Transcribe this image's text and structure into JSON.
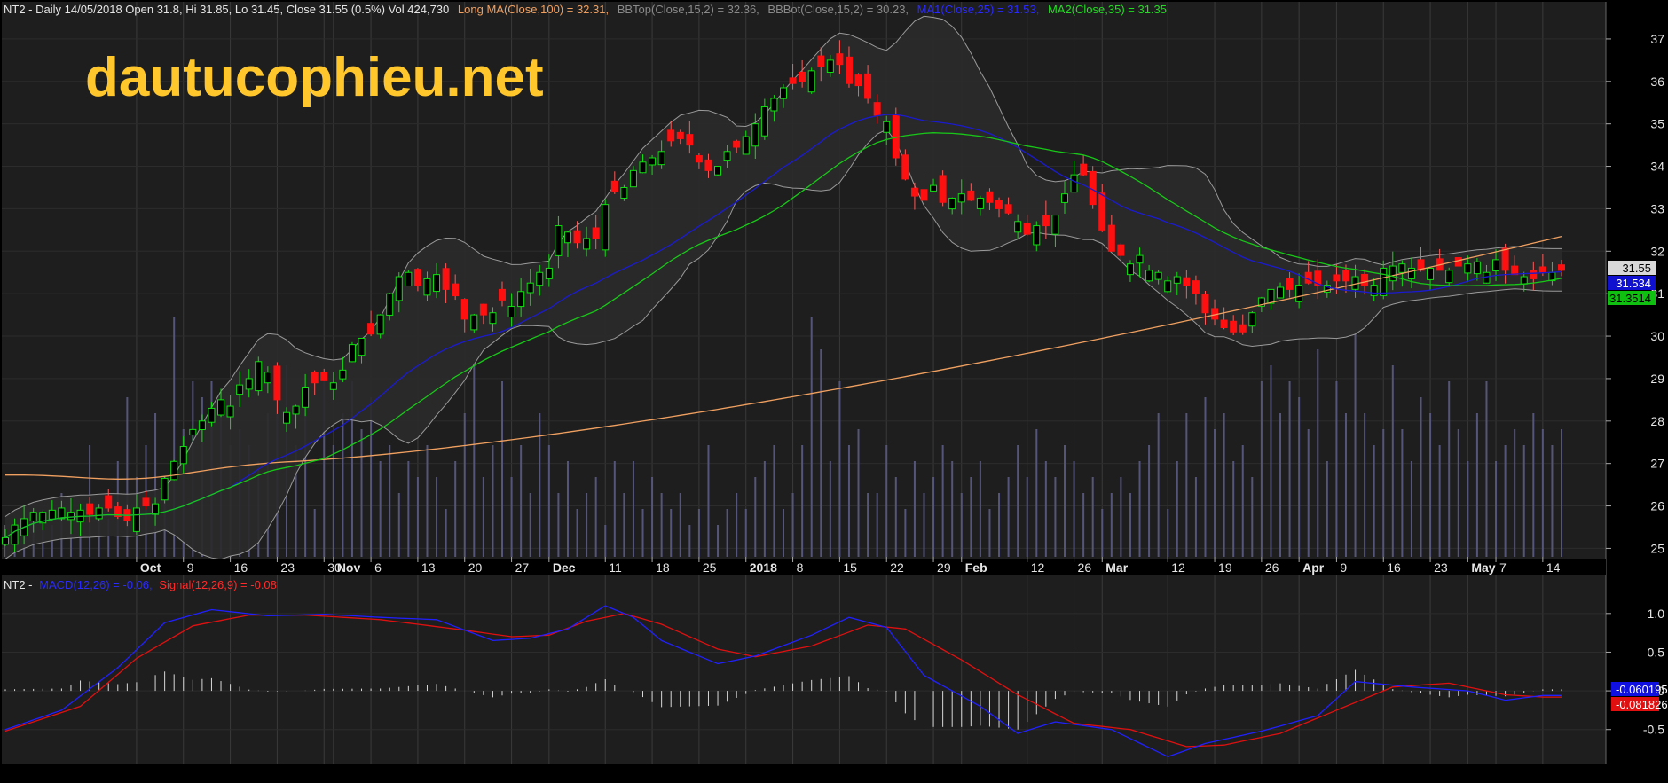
{
  "price_header": {
    "prefix": "NT2 - Daily 14/05/2018 Open 31.8, Hi 31.85, Lo 31.45, Close 31.55 (0.5%) Vol 424,730",
    "long_ma": "Long MA(Close,100) = 32.31,",
    "bbtop": "BBTop(Close,15,2) = 32.36,",
    "bbbot": "BBBot(Close,15,2) = 30.23,",
    "ma1": "MA1(Close,25) = 31.53,",
    "ma2": "MA2(Close,35) = 31.35"
  },
  "macd_header": {
    "prefix": "NT2 -",
    "macd": "MACD(12,26) = -0.06,",
    "signal": "Signal(12,26,9) = -0.08"
  },
  "watermark": "dautucophieu.net",
  "colors": {
    "background": "#000000",
    "panel": "#1e1e1e",
    "grid": "#3a3a3a",
    "up": "#10e010",
    "down": "#ff1010",
    "bb": "#9a9a9a",
    "bb_fill": "#2a2a2a",
    "long_ma": "#f0a060",
    "ma1": "#1a1ad0",
    "ma2": "#18c818",
    "volume": "#55557a",
    "macd": "#2020ff",
    "signal": "#e01010",
    "histogram": "#d8d8d8",
    "watermark": "#ffc72c"
  },
  "price_labels": {
    "close": "31.55",
    "ma1": "31.534",
    "ma2": "31.3514"
  },
  "macd_labels": {
    "macd": "-0.060195",
    "signal": "-0.081826"
  },
  "chart_data": [
    {
      "type": "candlestick",
      "title": "NT2 - Daily 14/05/2018",
      "ylim": [
        24.8,
        37.5
      ],
      "y_ticks": [
        25,
        26,
        27,
        28,
        29,
        30,
        31,
        32,
        33,
        34,
        35,
        36,
        37
      ],
      "x_tick_labels": [
        {
          "label": "Oct",
          "i": 14
        },
        {
          "label": "9",
          "i": 19
        },
        {
          "label": "16",
          "i": 24
        },
        {
          "label": "23",
          "i": 29
        },
        {
          "label": "30",
          "i": 34
        },
        {
          "label": "Nov",
          "i": 35
        },
        {
          "label": "6",
          "i": 39
        },
        {
          "label": "13",
          "i": 44
        },
        {
          "label": "20",
          "i": 49
        },
        {
          "label": "27",
          "i": 54
        },
        {
          "label": "Dec",
          "i": 58
        },
        {
          "label": "11",
          "i": 64
        },
        {
          "label": "18",
          "i": 69
        },
        {
          "label": "25",
          "i": 74
        },
        {
          "label": "2018",
          "i": 79
        },
        {
          "label": "8",
          "i": 84
        },
        {
          "label": "15",
          "i": 89
        },
        {
          "label": "22",
          "i": 94
        },
        {
          "label": "29",
          "i": 99
        },
        {
          "label": "Feb",
          "i": 102
        },
        {
          "label": "12",
          "i": 109
        },
        {
          "label": "26",
          "i": 114
        },
        {
          "label": "Mar",
          "i": 117
        },
        {
          "label": "12",
          "i": 124
        },
        {
          "label": "19",
          "i": 129
        },
        {
          "label": "26",
          "i": 134
        },
        {
          "label": "Apr",
          "i": 138
        },
        {
          "label": "9",
          "i": 142
        },
        {
          "label": "16",
          "i": 147
        },
        {
          "label": "23",
          "i": 152
        },
        {
          "label": "May",
          "i": 156
        },
        {
          "label": "7",
          "i": 159
        },
        {
          "label": "14",
          "i": 164
        }
      ],
      "close": [
        25.25,
        25.55,
        25.7,
        25.85,
        25.85,
        25.9,
        25.95,
        25.85,
        25.9,
        25.8,
        25.95,
        25.95,
        25.75,
        25.65,
        25.95,
        26.0,
        26.05,
        26.65,
        27.05,
        27.4,
        27.8,
        28.0,
        28.3,
        28.5,
        28.35,
        28.85,
        29.0,
        29.4,
        29.15,
        28.5,
        28.2,
        28.35,
        28.8,
        28.9,
        28.95,
        28.9,
        29.2,
        29.8,
        29.95,
        30.05,
        30.5,
        31.0,
        31.4,
        31.5,
        31.2,
        31.35,
        31.45,
        31.1,
        30.95,
        30.4,
        30.5,
        30.5,
        30.55,
        30.85,
        30.7,
        31.05,
        31.25,
        31.5,
        31.6,
        32.6,
        32.45,
        32.2,
        32.3,
        32.3,
        33.1,
        33.4,
        33.5,
        33.9,
        34.1,
        34.2,
        34.35,
        34.6,
        34.65,
        34.5,
        34.1,
        33.9,
        34.0,
        34.35,
        34.45,
        34.7,
        35.0,
        35.4,
        35.6,
        35.85,
        35.95,
        36.0,
        36.25,
        36.35,
        36.5,
        36.4,
        35.95,
        35.9,
        35.6,
        35.2,
        35.05,
        34.2,
        33.7,
        33.3,
        33.2,
        33.55,
        33.15,
        33.25,
        33.35,
        33.2,
        33.25,
        33.15,
        33.0,
        32.9,
        32.7,
        32.4,
        32.6,
        32.6,
        32.85,
        33.35,
        33.8,
        33.8,
        33.1,
        32.5,
        32.0,
        31.9,
        31.7,
        31.9,
        31.55,
        31.5,
        31.3,
        31.4,
        31.2,
        31.0,
        30.55,
        30.4,
        30.2,
        30.1,
        30.1,
        30.55,
        30.9,
        31.1,
        31.15,
        31.1,
        31.2,
        31.25,
        31.2,
        31.2,
        31.3,
        31.3,
        31.4,
        31.2,
        31.2,
        31.6,
        31.65,
        31.7,
        31.6,
        31.55,
        31.6,
        31.55,
        31.55,
        31.65,
        31.7,
        31.75,
        31.5,
        31.8,
        31.55,
        31.45,
        31.4,
        31.35,
        31.5,
        31.5,
        31.55
      ],
      "volume": [
        0.1,
        0.05,
        0.08,
        0.12,
        0.15,
        0.1,
        0.2,
        0.15,
        0.1,
        0.35,
        0.15,
        0.12,
        0.3,
        0.5,
        0.25,
        0.35,
        0.45,
        0.25,
        0.75,
        0.4,
        0.55,
        0.5,
        0.55,
        0.45,
        0.35,
        0.4,
        0.35,
        0.3,
        0.45,
        0.55,
        0.6,
        0.35,
        0.45,
        0.15,
        0.55,
        0.35,
        0.45,
        0.55,
        0.4,
        0.5,
        0.3,
        0.35,
        0.2,
        0.3,
        0.25,
        0.35,
        0.25,
        0.15,
        0.3,
        0.45,
        0.6,
        0.25,
        0.35,
        0.55,
        0.25,
        0.35,
        0.2,
        0.45,
        0.35,
        0.2,
        0.3,
        0.15,
        0.2,
        0.25,
        0.1,
        0.3,
        0.2,
        0.3,
        0.15,
        0.25,
        0.2,
        0.15,
        0.2,
        0.1,
        0.15,
        0.35,
        0.1,
        0.15,
        0.2,
        0.15,
        0.25,
        0.3,
        0.35,
        0.15,
        0.2,
        0.35,
        0.75,
        0.65,
        0.3,
        0.55,
        0.35,
        0.4,
        0.2,
        0.2,
        0.35,
        0.25,
        0.15,
        0.3,
        0.2,
        0.25,
        0.35,
        0.3,
        0.2,
        0.25,
        0.3,
        0.15,
        0.2,
        0.25,
        0.35,
        0.25,
        0.4,
        0.3,
        0.25,
        0.35,
        0.3,
        0.2,
        0.25,
        0.15,
        0.2,
        0.25,
        0.2,
        0.3,
        0.35,
        0.45,
        0.15,
        0.3,
        0.45,
        0.25,
        0.5,
        0.4,
        0.45,
        0.3,
        0.35,
        0.25,
        0.55,
        0.6,
        0.45,
        0.55,
        0.5,
        0.4,
        0.65,
        0.3,
        0.55,
        0.45,
        0.7,
        0.45,
        0.35,
        0.4,
        0.6,
        0.4,
        0.3,
        0.5,
        0.45,
        0.35,
        0.55,
        0.4,
        0.3,
        0.45,
        0.55,
        0.3,
        0.35,
        0.4,
        0.35,
        0.45,
        0.4,
        0.35,
        0.4
      ]
    },
    {
      "type": "line",
      "title": "NT2 - MACD",
      "ylim": [
        -0.95,
        1.25
      ],
      "y_ticks": [
        1.0,
        0.5,
        0.0,
        -0.5
      ],
      "y_tick_labels": [
        "1.0",
        "0.5",
        "0.0",
        "-0.5"
      ],
      "series": [
        {
          "name": "MACD(12,26)",
          "key": "macd"
        },
        {
          "name": "Signal(12,26,9)",
          "key": "signal"
        }
      ],
      "macd_keypoints": [
        [
          0,
          -0.5
        ],
        [
          6,
          -0.25
        ],
        [
          12,
          0.3
        ],
        [
          17,
          0.88
        ],
        [
          22,
          1.05
        ],
        [
          28,
          0.97
        ],
        [
          34,
          0.99
        ],
        [
          40,
          0.95
        ],
        [
          46,
          0.92
        ],
        [
          52,
          0.65
        ],
        [
          56,
          0.68
        ],
        [
          60,
          0.8
        ],
        [
          64,
          1.1
        ],
        [
          67,
          0.95
        ],
        [
          70,
          0.65
        ],
        [
          76,
          0.35
        ],
        [
          80,
          0.45
        ],
        [
          86,
          0.72
        ],
        [
          90,
          0.95
        ],
        [
          94,
          0.82
        ],
        [
          98,
          0.2
        ],
        [
          104,
          -0.2
        ],
        [
          108,
          -0.55
        ],
        [
          112,
          -0.4
        ],
        [
          118,
          -0.5
        ],
        [
          124,
          -0.85
        ],
        [
          128,
          -0.68
        ],
        [
          134,
          -0.52
        ],
        [
          140,
          -0.32
        ],
        [
          144,
          0.12
        ],
        [
          150,
          0.05
        ],
        [
          156,
          0.0
        ],
        [
          160,
          -0.12
        ],
        [
          164,
          -0.06
        ]
      ],
      "signal_keypoints": [
        [
          0,
          -0.52
        ],
        [
          8,
          -0.2
        ],
        [
          14,
          0.42
        ],
        [
          20,
          0.84
        ],
        [
          26,
          0.98
        ],
        [
          32,
          0.98
        ],
        [
          40,
          0.92
        ],
        [
          48,
          0.8
        ],
        [
          54,
          0.7
        ],
        [
          58,
          0.72
        ],
        [
          62,
          0.9
        ],
        [
          66,
          1.0
        ],
        [
          70,
          0.86
        ],
        [
          76,
          0.54
        ],
        [
          80,
          0.44
        ],
        [
          86,
          0.58
        ],
        [
          92,
          0.85
        ],
        [
          96,
          0.8
        ],
        [
          102,
          0.4
        ],
        [
          108,
          -0.05
        ],
        [
          114,
          -0.42
        ],
        [
          120,
          -0.5
        ],
        [
          126,
          -0.72
        ],
        [
          130,
          -0.7
        ],
        [
          136,
          -0.55
        ],
        [
          142,
          -0.25
        ],
        [
          148,
          0.05
        ],
        [
          154,
          0.1
        ],
        [
          160,
          -0.05
        ],
        [
          164,
          -0.08
        ]
      ]
    }
  ]
}
